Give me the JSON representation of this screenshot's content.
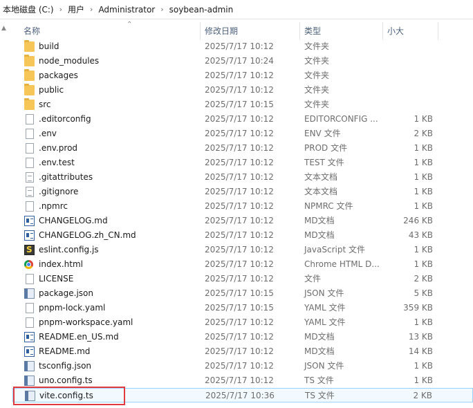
{
  "breadcrumb": [
    "本地磁盘 (C:)",
    "用户",
    "Administrator",
    "soybean-admin"
  ],
  "breadcrumb_separator": "›",
  "columns": {
    "name": "名称",
    "date": "修改日期",
    "type": "类型",
    "size": "小大"
  },
  "files": [
    {
      "name": "build",
      "date": "2025/7/17 10:12",
      "type": "文件夹",
      "size": "",
      "icon": "folder-icon"
    },
    {
      "name": "node_modules",
      "date": "2025/7/17 10:24",
      "type": "文件夹",
      "size": "",
      "icon": "folder-icon"
    },
    {
      "name": "packages",
      "date": "2025/7/17 10:12",
      "type": "文件夹",
      "size": "",
      "icon": "folder-icon"
    },
    {
      "name": "public",
      "date": "2025/7/17 10:12",
      "type": "文件夹",
      "size": "",
      "icon": "folder-icon"
    },
    {
      "name": "src",
      "date": "2025/7/17 10:15",
      "type": "文件夹",
      "size": "",
      "icon": "folder-icon"
    },
    {
      "name": ".editorconfig",
      "date": "2025/7/17 10:12",
      "type": "EDITORCONFIG ...",
      "size": "1 KB",
      "icon": "file-icon"
    },
    {
      "name": ".env",
      "date": "2025/7/17 10:12",
      "type": "ENV 文件",
      "size": "2 KB",
      "icon": "file-icon"
    },
    {
      "name": ".env.prod",
      "date": "2025/7/17 10:12",
      "type": "PROD 文件",
      "size": "1 KB",
      "icon": "file-icon"
    },
    {
      "name": ".env.test",
      "date": "2025/7/17 10:12",
      "type": "TEST 文件",
      "size": "1 KB",
      "icon": "file-icon"
    },
    {
      "name": ".gitattributes",
      "date": "2025/7/17 10:12",
      "type": "文本文档",
      "size": "1 KB",
      "icon": "text-file-icon"
    },
    {
      "name": ".gitignore",
      "date": "2025/7/17 10:12",
      "type": "文本文档",
      "size": "1 KB",
      "icon": "text-file-icon"
    },
    {
      "name": ".npmrc",
      "date": "2025/7/17 10:12",
      "type": "NPMRC 文件",
      "size": "1 KB",
      "icon": "file-icon"
    },
    {
      "name": "CHANGELOG.md",
      "date": "2025/7/17 10:12",
      "type": "MD文档",
      "size": "246 KB",
      "icon": "markdown-icon"
    },
    {
      "name": "CHANGELOG.zh_CN.md",
      "date": "2025/7/17 10:12",
      "type": "MD文档",
      "size": "43 KB",
      "icon": "markdown-icon"
    },
    {
      "name": "eslint.config.js",
      "date": "2025/7/17 10:12",
      "type": "JavaScript 文件",
      "size": "1 KB",
      "icon": "javascript-icon"
    },
    {
      "name": "index.html",
      "date": "2025/7/17 10:12",
      "type": "Chrome HTML D...",
      "size": "1 KB",
      "icon": "chrome-icon"
    },
    {
      "name": "LICENSE",
      "date": "2025/7/17 10:12",
      "type": "文件",
      "size": "2 KB",
      "icon": "file-icon"
    },
    {
      "name": "package.json",
      "date": "2025/7/17 10:15",
      "type": "JSON 文件",
      "size": "5 KB",
      "icon": "json-icon"
    },
    {
      "name": "pnpm-lock.yaml",
      "date": "2025/7/17 10:15",
      "type": "YAML 文件",
      "size": "359 KB",
      "icon": "file-icon"
    },
    {
      "name": "pnpm-workspace.yaml",
      "date": "2025/7/17 10:12",
      "type": "YAML 文件",
      "size": "1 KB",
      "icon": "file-icon"
    },
    {
      "name": "README.en_US.md",
      "date": "2025/7/17 10:12",
      "type": "MD文档",
      "size": "13 KB",
      "icon": "markdown-icon"
    },
    {
      "name": "README.md",
      "date": "2025/7/17 10:12",
      "type": "MD文档",
      "size": "14 KB",
      "icon": "markdown-icon"
    },
    {
      "name": "tsconfig.json",
      "date": "2025/7/17 10:12",
      "type": "JSON 文件",
      "size": "1 KB",
      "icon": "json-icon"
    },
    {
      "name": "uno.config.ts",
      "date": "2025/7/17 10:12",
      "type": "TS 文件",
      "size": "1 KB",
      "icon": "json-icon"
    },
    {
      "name": "vite.config.ts",
      "date": "2025/7/17 10:36",
      "type": "TS 文件",
      "size": "2 KB",
      "icon": "json-icon",
      "selected": true
    }
  ],
  "colors": {
    "header_text": "#4c607a",
    "selection_border": "#99d1ff",
    "highlight_box": "#e0393e",
    "folder": "#f6c758"
  }
}
